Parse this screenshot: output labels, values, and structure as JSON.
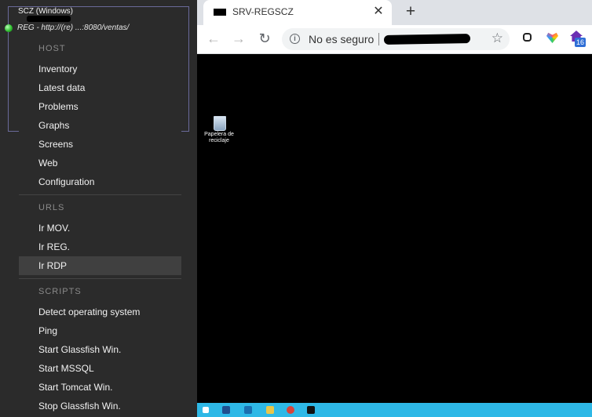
{
  "zabbix": {
    "host_title": "SCZ (Windows)",
    "host_link": "REG - http://(re) ...:8080/ventas/",
    "menu": [
      {
        "header": "HOST",
        "items": [
          "Inventory",
          "Latest data",
          "Problems",
          "Graphs",
          "Screens",
          "Web",
          "Configuration"
        ]
      },
      {
        "header": "URLS",
        "items": [
          "Ir MOV.",
          "Ir REG.",
          "Ir RDP"
        ]
      },
      {
        "header": "SCRIPTS",
        "items": [
          "Detect operating system",
          "Ping",
          "Start Glassfish Win.",
          "Start MSSQL",
          "Start Tomcat Win.",
          "Stop Glassfish Win."
        ]
      }
    ],
    "active_item": "Ir RDP"
  },
  "browser": {
    "tab_title": "SRV-REGSCZ",
    "tab_close": "✕",
    "new_tab": "+",
    "back": "←",
    "forward": "→",
    "reload": "↻",
    "security_label": "No es seguro",
    "bookmark_star": "☆",
    "extension_badge": "16"
  },
  "remote_desktop": {
    "desktop_icon_label": "Papelera de reciclaje",
    "taskbar_icons": [
      "start-icon",
      "explorer-icon",
      "network-icon",
      "folder-icon",
      "app-icon",
      "cmd-icon"
    ]
  },
  "colors": {
    "zabbix_bg": "#2b2b2b",
    "active_item_bg": "#404040",
    "taskbar": "#2eb8e6",
    "status_green": "#2fbf2f"
  }
}
